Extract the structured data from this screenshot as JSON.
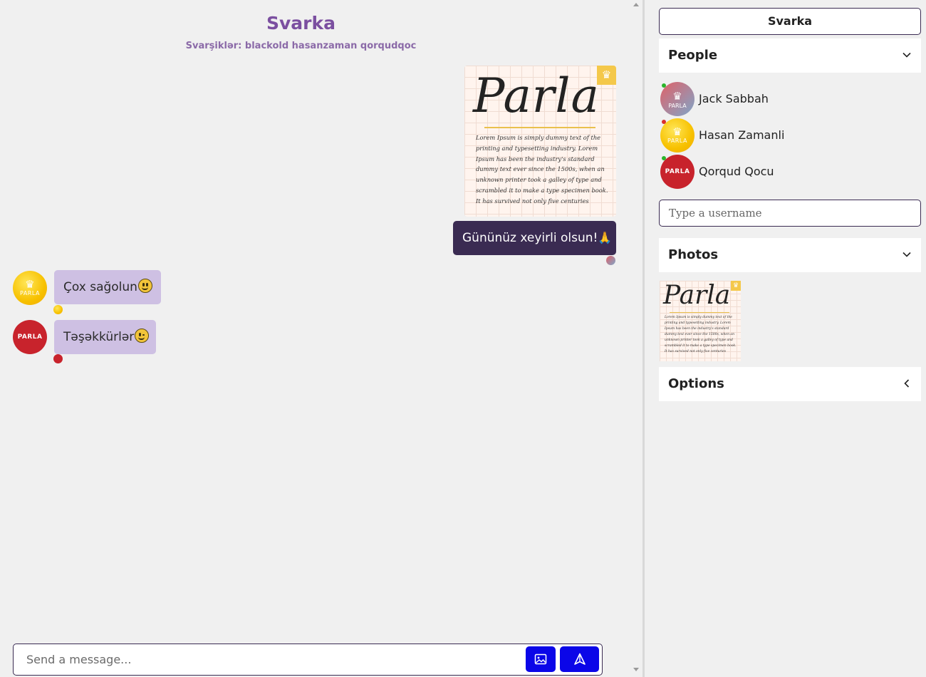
{
  "chat": {
    "title": "Svarka",
    "subtitle": "Svarşiklər: blackold hasanzaman qorqudqoc",
    "image_message": {
      "logo": "Parla",
      "text": "Lorem Ipsum is simply dummy text of the printing and typesetting industry. Lorem Ipsum has been the industry's standard dummy text ever since the 1500s, when an unknown printer took a galley of type and scrambled it to make a type specimen book. It has survived not only five centuries"
    },
    "messages": [
      {
        "direction": "out",
        "text": "Gününüz xeyirli olsun!",
        "emoji": "folded-hands"
      },
      {
        "direction": "in",
        "text": "Çox sağolun",
        "emoji": "grinning-face",
        "avatar": "PARLA"
      },
      {
        "direction": "in",
        "text": "Təşəkkürlər",
        "emoji": "winking-face",
        "avatar": "PARLA"
      }
    ],
    "composer": {
      "placeholder": "Send a message..."
    }
  },
  "sidebar": {
    "room": "Svarka",
    "people_title": "People",
    "people": [
      {
        "name": "Jack Sabbah",
        "avatar": "PARLA",
        "status_color": "#2bb52b"
      },
      {
        "name": "Hasan Zamanli",
        "avatar": "PARLA",
        "status_color": "#d9302c"
      },
      {
        "name": "Qorqud Qocu",
        "avatar": "PARLA",
        "status_color": "#2bb52b"
      }
    ],
    "username_placeholder": "Type a username",
    "photos_title": "Photos",
    "photo_thumb": {
      "logo": "Parla",
      "text": "Lorem Ipsum is simply dummy text of the printing and typesetting industry. Lorem Ipsum has been the industry's standard dummy text ever since the 1500s, when an unknown printer took a galley of type and scrambled it to make a type specimen book. It has survived not only five centuries"
    },
    "options_title": "Options"
  },
  "colors": {
    "accent": "#7b4fa0",
    "outgoing_bubble": "#3a2b52",
    "incoming_bubble": "#cec0e3",
    "button_blue": "#0b06e8",
    "avatar_red": "#c8232c",
    "avatar_gold": "#f7c100"
  }
}
